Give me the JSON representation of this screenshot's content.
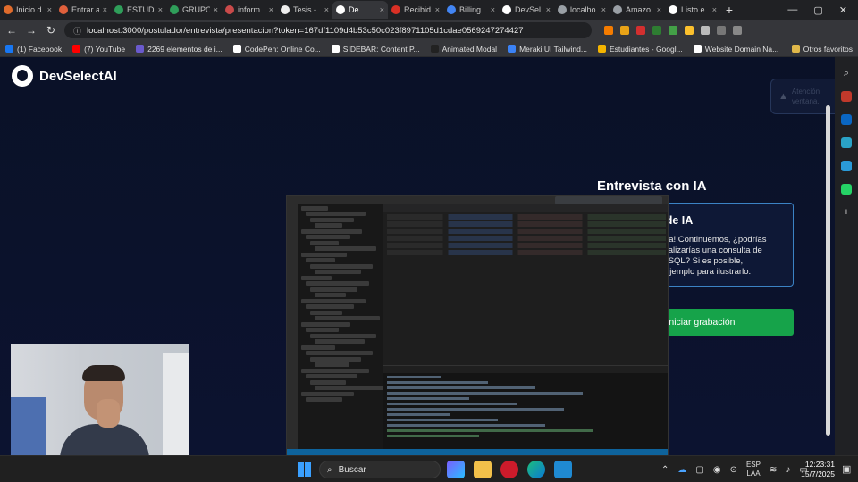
{
  "browser": {
    "tabs": [
      {
        "label": "Inicio d",
        "color": "#e06c2c"
      },
      {
        "label": "Entrar a",
        "color": "#e0603c"
      },
      {
        "label": "ESTUDI",
        "color": "#2f9e5a"
      },
      {
        "label": "GRUPO",
        "color": "#2f9e5a"
      },
      {
        "label": "inform",
        "color": "#c94a4a"
      },
      {
        "label": "Tesis -",
        "color": "#eeeeee"
      },
      {
        "label": "De",
        "color": "#ffffff",
        "active": true
      },
      {
        "label": "Recibid",
        "color": "#d93025"
      },
      {
        "label": "Billing",
        "color": "#4285f4"
      },
      {
        "label": "DevSel",
        "color": "#ffffff"
      },
      {
        "label": "localho",
        "color": "#9aa0a6"
      },
      {
        "label": "Amazo",
        "color": "#9aa0a6"
      },
      {
        "label": "Listo e",
        "color": "#ffffff"
      }
    ],
    "url": "localhost:3000/postulador/entrevista/presentacion?token=167df1109d4b53c50c023f8971105d1cdae0569247274427",
    "bookmarks": [
      {
        "label": "(1) Facebook",
        "color": "#1877f2"
      },
      {
        "label": "(7) YouTube",
        "color": "#ff0000"
      },
      {
        "label": "2269 elementos de i...",
        "color": "#6a5acd"
      },
      {
        "label": "CodePen: Online Co...",
        "color": "#ffffff"
      },
      {
        "label": "SIDEBAR: Content P...",
        "color": "#ffffff"
      },
      {
        "label": "Animated Modal",
        "color": "#222222"
      },
      {
        "label": "Meraki UI Tailwind...",
        "color": "#3b82f6"
      },
      {
        "label": "Estudiantes - Googl...",
        "color": "#f4b400"
      },
      {
        "label": "Website Domain Na...",
        "color": "#ffffff"
      }
    ],
    "other_bookmarks": "Otros favoritos"
  },
  "app": {
    "brand": "DevSelectAI",
    "toast": "Atención ventana.",
    "interview_title": "Entrevista con IA",
    "response_title": "Respuesta de IA",
    "response_body": "¡No hay problema! Continuemos, ¿podrías explicar cómo realizarías una consulta de unión (JOIN) en SQL? Si es posible, proporciona un ejemplo para ilustrarlo.",
    "record_button": "Iniciar grabación"
  },
  "taskbar": {
    "search_placeholder": "Buscar",
    "language": "ESP",
    "layout": "LAA",
    "time": "12:23:31",
    "date": "15/7/2025"
  },
  "colors": {
    "accent": "#16a34a",
    "card_border": "#3b82c4",
    "page_bg": "#0b1228"
  }
}
